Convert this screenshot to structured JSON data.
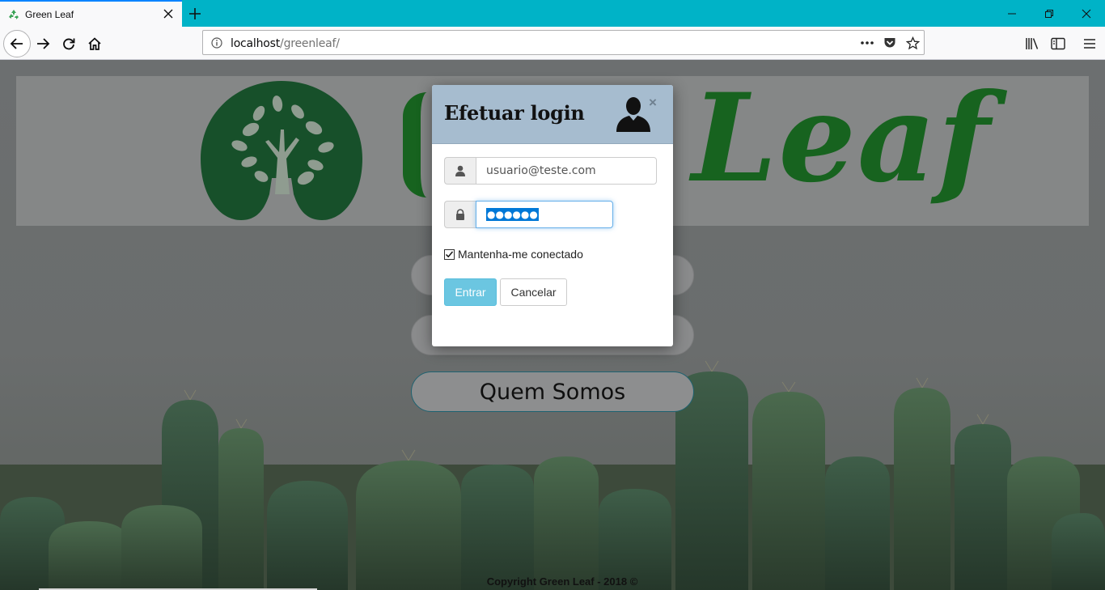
{
  "browser": {
    "tab_title": "Green Leaf",
    "url_host": "localhost",
    "url_path": "/greenleaf/",
    "icons": [
      "recycle-favicon",
      "close-icon",
      "plus-icon",
      "minimize-icon",
      "restore-icon",
      "close-window-icon",
      "back-icon",
      "forward-icon",
      "reload-icon",
      "home-icon",
      "info-icon",
      "more-icon",
      "pocket-icon",
      "star-icon",
      "library-icon",
      "sidebar-icon",
      "menu-icon"
    ],
    "accent": "#00b3c7"
  },
  "site": {
    "logo_text": "Leaf",
    "brand_color": "#17631f",
    "menu": {
      "quem_somos": "Quem Somos"
    },
    "copyright": "Copyright Green Leaf - 2018 ©"
  },
  "login_modal": {
    "title": "Efetuar login",
    "close_symbol": "×",
    "email_value": "usuario@teste.com",
    "password_mask": "●●●●●●",
    "remember_label": "Mantenha-me conectado",
    "remember_checked": true,
    "submit_label": "Entrar",
    "cancel_label": "Cancelar",
    "header_color": "#a6bccf",
    "submit_color": "#5bc0de"
  }
}
